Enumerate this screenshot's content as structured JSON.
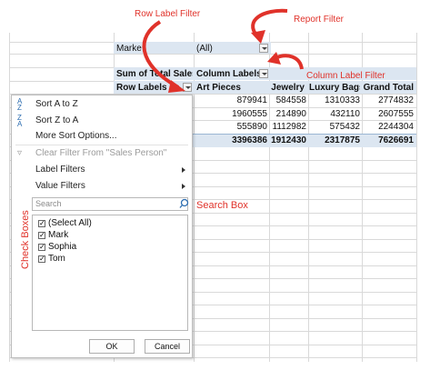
{
  "annotations": {
    "row_label_filter": "Row Label Filter",
    "report_filter": "Report Filter",
    "column_label_filter": "Column Label Filter",
    "search_box": "Search Box",
    "check_boxes": "Check Boxes"
  },
  "pivot": {
    "filter_field": "Marke",
    "filter_value": "(All)",
    "sum_of_label": "Sum of Total Sales",
    "column_labels": "Column Labels",
    "row_labels": "Row Labels",
    "columns": [
      "Art Pieces",
      "Jewelry",
      "Luxury Bags",
      "Grand Total"
    ],
    "rows": [
      [
        "879941",
        "584558",
        "1310333",
        "2774832"
      ],
      [
        "1960555",
        "214890",
        "432110",
        "2607555"
      ],
      [
        "555890",
        "1112982",
        "575432",
        "2244304"
      ]
    ],
    "totals": [
      "3396386",
      "1912430",
      "2317875",
      "7626691"
    ]
  },
  "menu": {
    "sort_az": "Sort A to Z",
    "sort_za": "Sort Z to A",
    "more_sort": "More Sort Options...",
    "clear_filter": "Clear Filter From \"Sales Person\"",
    "label_filters": "Label Filters",
    "value_filters": "Value Filters",
    "search_placeholder": "Search",
    "checkboxes": [
      {
        "label": "(Select All)",
        "checked": true
      },
      {
        "label": "Mark",
        "checked": true
      },
      {
        "label": "Sophia",
        "checked": true
      },
      {
        "label": "Tom",
        "checked": true
      }
    ],
    "ok": "OK",
    "cancel": "Cancel"
  },
  "colors": {
    "annotation": "#e0322a",
    "header_band": "#dce6f1",
    "menu_icon": "#2b6cb0"
  }
}
